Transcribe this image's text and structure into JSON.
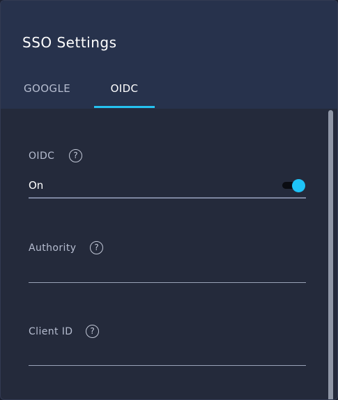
{
  "dialog": {
    "title": "SSO Settings"
  },
  "tabs": [
    {
      "label": "GOOGLE",
      "selected": false
    },
    {
      "label": "OIDC",
      "selected": true
    }
  ],
  "fields": {
    "oidc": {
      "label": "OIDC",
      "value": "On",
      "toggle_on": true
    },
    "authority": {
      "label": "Authority",
      "value": ""
    },
    "client_id": {
      "label": "Client ID",
      "value": ""
    }
  },
  "colors": {
    "accent": "#25c2f0",
    "header_bg": "#27324c",
    "body_bg": "#242a3b"
  },
  "icons": {
    "help": "help-circle-icon"
  }
}
